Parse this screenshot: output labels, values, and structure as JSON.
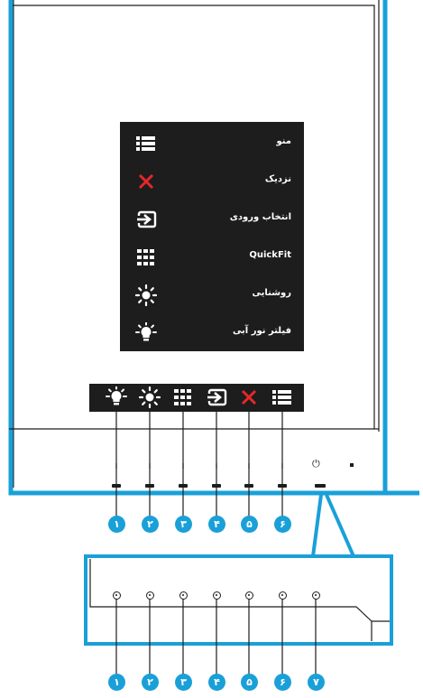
{
  "menu": {
    "items": [
      {
        "label": "منو",
        "icon": "menu-list-icon"
      },
      {
        "label": "نزدیک",
        "icon": "close-x-icon"
      },
      {
        "label": "انتخاب ورودی",
        "icon": "input-select-icon"
      },
      {
        "label": "QuickFit",
        "icon": "quickfit-grid-icon"
      },
      {
        "label": "روشنایی",
        "icon": "brightness-sun-icon"
      },
      {
        "label": "فیلتر نور آبی",
        "icon": "blue-light-filter-icon"
      }
    ]
  },
  "button_bar": {
    "icons": [
      "blue-light-filter-icon",
      "brightness-sun-icon",
      "quickfit-grid-icon",
      "input-select-icon",
      "close-x-icon",
      "menu-list-icon"
    ]
  },
  "callouts_top": [
    "١",
    "٢",
    "٣",
    "۴",
    "۵",
    "۶"
  ],
  "callouts_bottom": [
    "١",
    "٢",
    "٣",
    "۴",
    "۵",
    "۶",
    "٧"
  ],
  "power_symbol": "⏻",
  "colors": {
    "accent": "#1aa0d8",
    "panel": "#1d1d1d",
    "close": "#e8262b",
    "line": "#1d1d1d"
  }
}
